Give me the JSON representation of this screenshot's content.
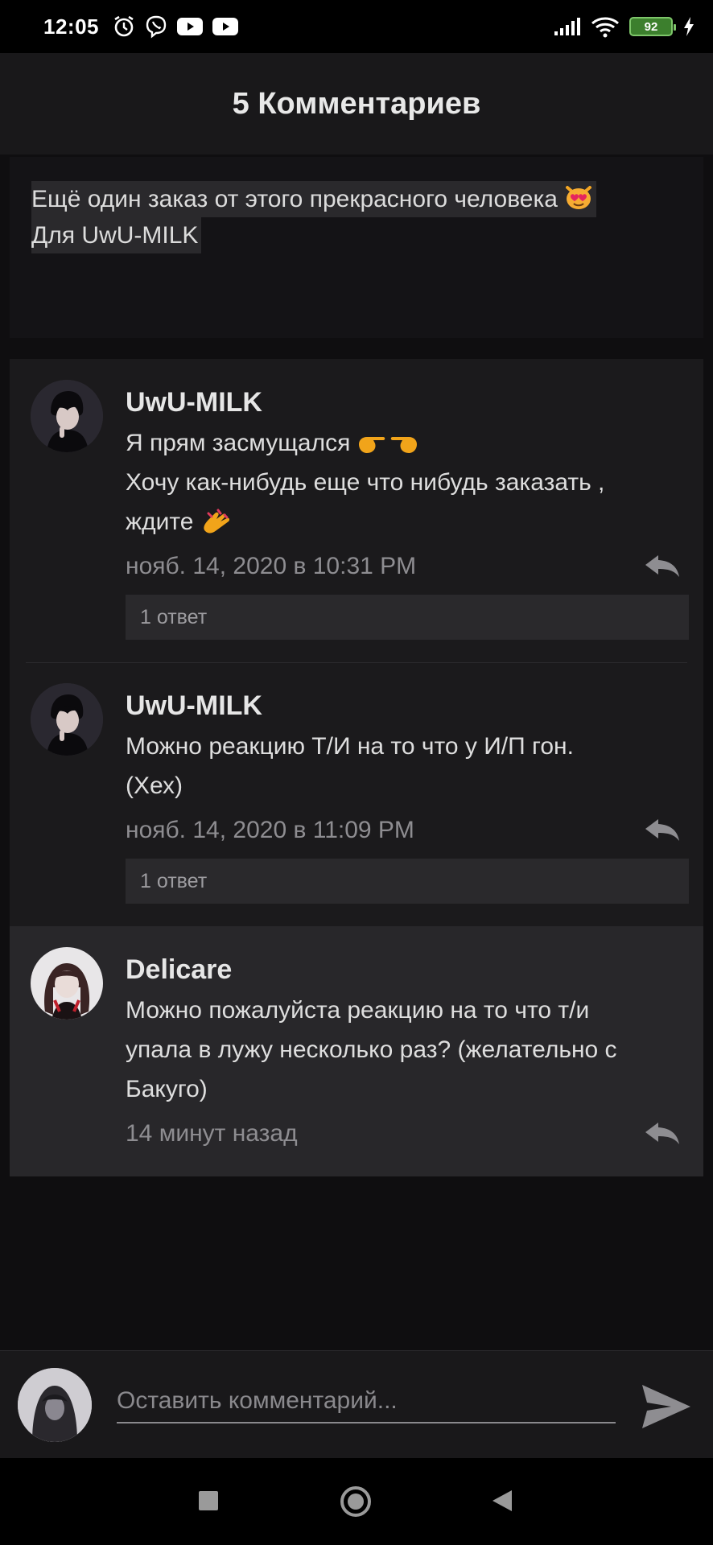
{
  "status_bar": {
    "time": "12:05",
    "battery": "92",
    "icons": [
      "alarm-icon",
      "viber-icon",
      "youtube-icon",
      "youtube-icon",
      "signal-icon",
      "wifi-icon",
      "battery-icon",
      "charging-icon"
    ]
  },
  "header": {
    "title": "5 Комментариев"
  },
  "post": {
    "line1": "Ещё один заказ от этого прекрасного человека",
    "line2": "Для UwU-MILK",
    "emoji": "heart-eyes-cat-icon"
  },
  "comments": [
    {
      "author": "UwU-MILK",
      "lines": [
        "Я прям засмущался",
        "Хочу как-нибудь еще что нибудь заказать ,",
        "ждите"
      ],
      "emojis": [
        "pointing-fingers-icon",
        "nail-polish-icon"
      ],
      "timestamp": "нояб. 14, 2020 в 10:31 PM",
      "replies": "1 ответ"
    },
    {
      "author": "UwU-MILK",
      "lines": [
        "Можно реакцию Т/И на то что у И/П гон.",
        "(Хех)"
      ],
      "timestamp": "нояб. 14, 2020 в 11:09 PM",
      "replies": "1 ответ"
    },
    {
      "author": "Delicare",
      "lines": [
        "Можно пожалуйста реакцию на то что т/и",
        "упала в лужу несколько раз? (желательно с",
        "Бакуго)"
      ],
      "timestamp": "14 минут назад"
    }
  ],
  "input": {
    "placeholder": "Оставить комментарий..."
  },
  "colors": {
    "background": "#0f0e10",
    "panel": "#1b1a1c",
    "highlight": "#28272a",
    "muted_text": "#8e8d91"
  }
}
